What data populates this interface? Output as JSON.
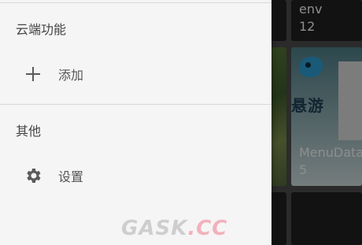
{
  "background": {
    "tiles": [
      {
        "title": "env",
        "count": "12"
      },
      {
        "logo_text": "悬游",
        "title": "MenuData",
        "count": "5"
      }
    ]
  },
  "drawer": {
    "cloud_section": {
      "header": "云端功能",
      "items": [
        {
          "label": "添加",
          "icon": "plus-icon"
        }
      ]
    },
    "other_section": {
      "header": "其他",
      "items": [
        {
          "label": "设置",
          "icon": "gear-icon"
        }
      ]
    }
  },
  "watermark": {
    "part1": "GASK",
    "part2": ".CC"
  },
  "colors": {
    "drawer_bg": "#f5f5f5",
    "icon": "#5a5a5a",
    "scrim": "rgba(0,0,0,0.42)"
  }
}
